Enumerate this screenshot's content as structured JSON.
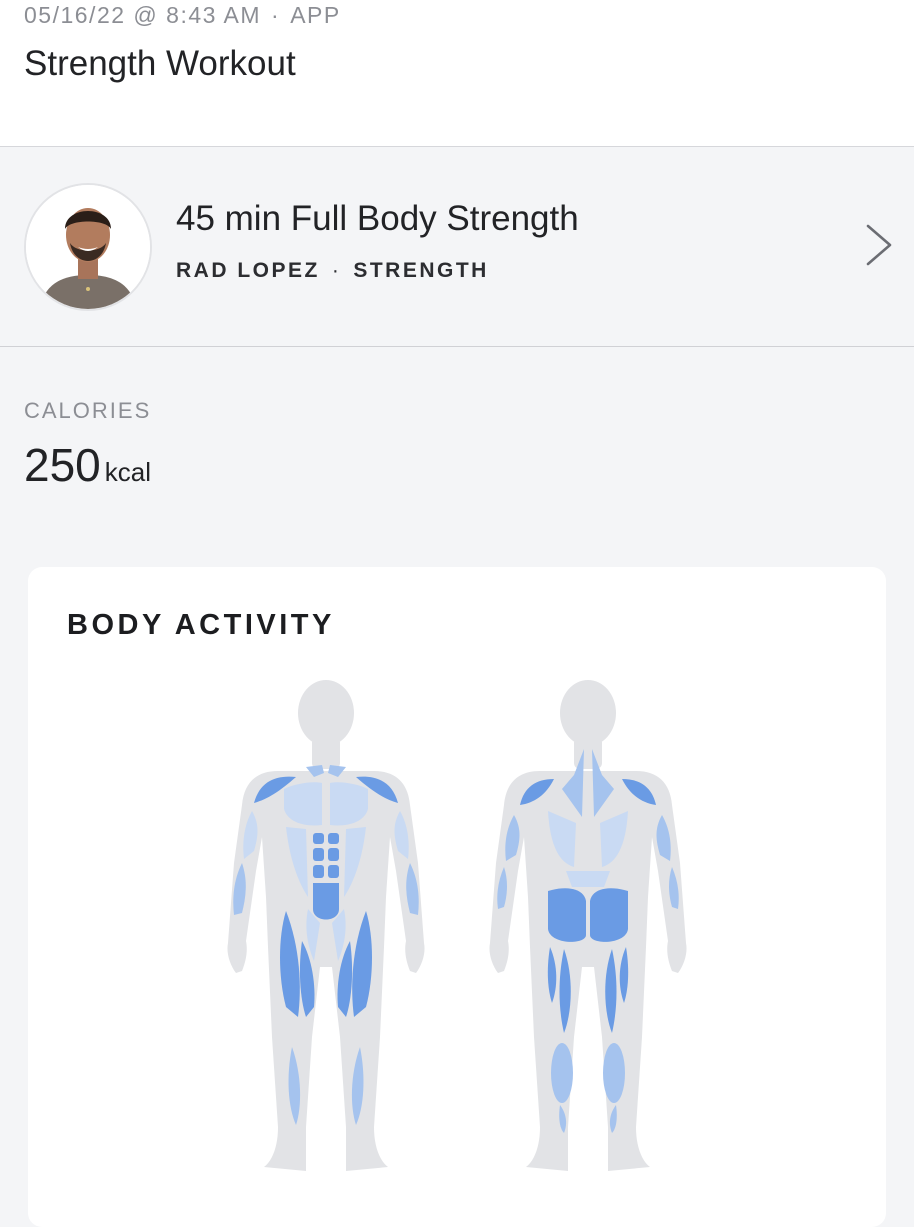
{
  "header": {
    "date": "05/16/22 @ 8:43 AM",
    "separator": "·",
    "source": "APP",
    "title": "Strength Workout"
  },
  "workout": {
    "class_name": "45 min Full Body Strength",
    "instructor": "RAD LOPEZ",
    "separator": "·",
    "category": "STRENGTH",
    "chevron_icon": "chevron-right-icon"
  },
  "calories": {
    "label": "CALORIES",
    "value": "250",
    "unit": "kcal"
  },
  "body_activity": {
    "title": "BODY ACTIVITY",
    "colors": {
      "body": "#e2e3e6",
      "low": "#c9daf3",
      "medium": "#a5c3ee",
      "high": "#6a9be4"
    },
    "front": {
      "shoulders": "high",
      "chest": "low",
      "traps": "medium",
      "biceps": "low",
      "forearms": "medium",
      "abs": "high",
      "obliques": "low",
      "quads": "high",
      "adductors": "low",
      "shins": "medium"
    },
    "back": {
      "traps": "medium",
      "rear_delts": "high",
      "lats": "low",
      "triceps": "medium",
      "lower_back": "low",
      "glutes": "high",
      "hamstrings": "high",
      "calves": "medium"
    }
  }
}
